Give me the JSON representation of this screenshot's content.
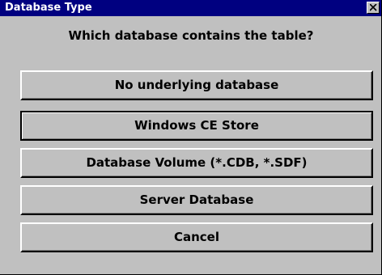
{
  "window": {
    "title": "Database Type"
  },
  "dialog": {
    "question": "Which database contains the table?",
    "buttons": [
      {
        "label": "No underlying database"
      },
      {
        "label": "Windows CE Store"
      },
      {
        "label": "Database Volume (*.CDB, *.SDF)"
      },
      {
        "label": "Server Database"
      },
      {
        "label": "Cancel"
      }
    ]
  },
  "colors": {
    "titlebar": "#000080",
    "face": "#c0c0c0"
  },
  "icons": {
    "close": "close-icon"
  }
}
